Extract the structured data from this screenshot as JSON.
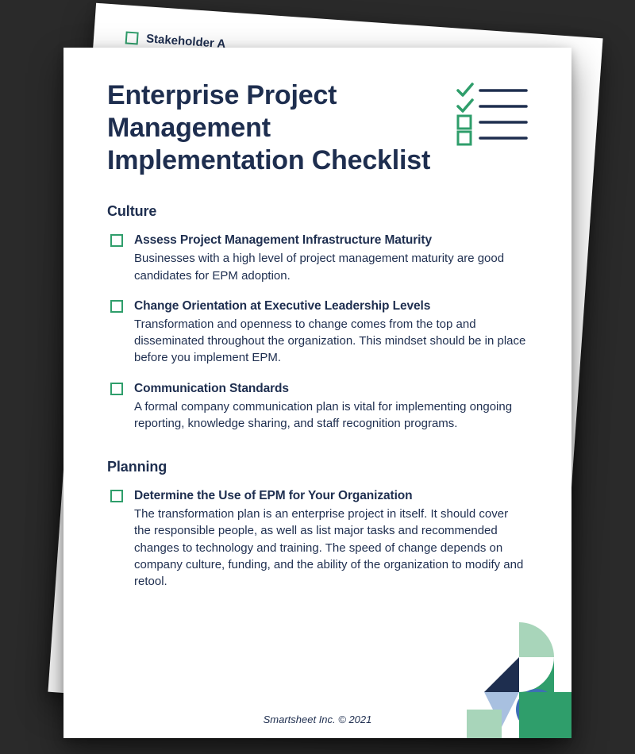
{
  "back_page": {
    "peek_text": "Stakeholder A"
  },
  "title": "Enterprise Project Management Implementation Checklist",
  "sections": [
    {
      "name": "Culture",
      "items": [
        {
          "title": "Assess Project Management Infrastructure Maturity",
          "desc": "Businesses with a high level of project management maturity are good candidates for EPM adoption."
        },
        {
          "title": "Change Orientation at Executive Leadership Levels",
          "desc": "Transformation and openness to change comes from the top and disseminated throughout the organization. This mindset should be in place before you implement EPM."
        },
        {
          "title": "Communication Standards",
          "desc": "A formal company communication plan is vital for implementing ongoing reporting, knowledge sharing, and staff recognition programs."
        }
      ]
    },
    {
      "name": "Planning",
      "items": [
        {
          "title": "Determine the Use of EPM for Your Organization",
          "desc": "The transformation plan is an enterprise project in itself. It should cover the responsible people, as well as list major tasks and recommended changes to technology and training. The speed of change depends on company culture, funding, and the ability of the organization to modify and retool."
        }
      ]
    }
  ],
  "footer": "Smartsheet Inc. © 2021",
  "colors": {
    "navy": "#1e2e4f",
    "green": "#2f9e6b",
    "lightgreen": "#a8d5ba",
    "blue": "#3d6fb4",
    "lightblue": "#a8c0e0"
  }
}
